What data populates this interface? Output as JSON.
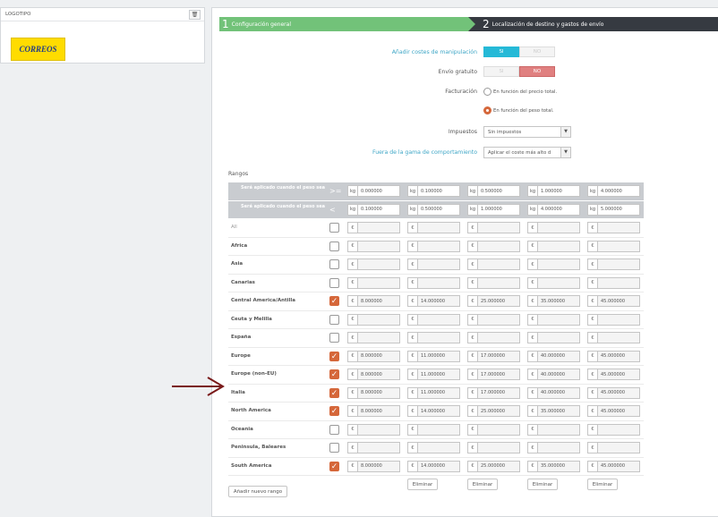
{
  "logo_panel": {
    "title": "LOGOTIPO",
    "trash_icon": "trash-icon",
    "logo_text": "CORREOS"
  },
  "steps": [
    {
      "num": "1",
      "label": "Configuración general"
    },
    {
      "num": "2",
      "label": "Localización de destino y gastos de envío"
    }
  ],
  "form": {
    "handling_label": "Añadir costes de manipulación",
    "handling_yes": "SI",
    "handling_no": "NO",
    "free_label": "Envío gratuito",
    "free_yes": "SI",
    "free_no": "NO",
    "billing_label": "Facturación",
    "billing_opt1": "En función del precio total.",
    "billing_opt2": "En función del peso total.",
    "taxes_label": "Impuestos",
    "taxes_value": "Sin impuestos",
    "out_of_range_label": "Fuera de la gama de comportamiento",
    "out_of_range_value": "Aplicar el coste más alto d"
  },
  "ranges": {
    "title": "Rangos",
    "header_ge": {
      "desc": "Será aplicado cuando el peso sea",
      "op": ">=",
      "unit": "kg",
      "values": [
        "0.000000",
        "0.100000",
        "0.500000",
        "1.000000",
        "4.000000"
      ]
    },
    "header_lt": {
      "desc": "Será aplicado cuando el peso sea",
      "op": "<",
      "unit": "kg",
      "values": [
        "0.100000",
        "0.500000",
        "1.000000",
        "4.000000",
        "5.000000"
      ]
    },
    "currency": "€",
    "zones": [
      {
        "name": "All",
        "checked": false,
        "prices": [
          "",
          "",
          "",
          "",
          ""
        ]
      },
      {
        "name": "Africa",
        "checked": false,
        "prices": [
          "",
          "",
          "",
          "",
          ""
        ]
      },
      {
        "name": "Asia",
        "checked": false,
        "prices": [
          "",
          "",
          "",
          "",
          ""
        ]
      },
      {
        "name": "Canarias",
        "checked": false,
        "prices": [
          "",
          "",
          "",
          "",
          ""
        ]
      },
      {
        "name": "Central America/Antilla",
        "checked": true,
        "prices": [
          "8.000000",
          "14.000000",
          "25.000000",
          "35.000000",
          "45.000000"
        ]
      },
      {
        "name": "Ceuta y Melilla",
        "checked": false,
        "prices": [
          "",
          "",
          "",
          "",
          ""
        ]
      },
      {
        "name": "España",
        "checked": false,
        "prices": [
          "",
          "",
          "",
          "",
          ""
        ]
      },
      {
        "name": "Europe",
        "checked": true,
        "prices": [
          "8.000000",
          "11.000000",
          "17.000000",
          "40.000000",
          "45.000000"
        ]
      },
      {
        "name": "Europe (non-EU)",
        "checked": true,
        "prices": [
          "8.000000",
          "11.000000",
          "17.000000",
          "40.000000",
          "45.000000"
        ]
      },
      {
        "name": "Italia",
        "checked": true,
        "prices": [
          "8.000000",
          "11.000000",
          "17.000000",
          "40.000000",
          "45.000000"
        ]
      },
      {
        "name": "North America",
        "checked": true,
        "prices": [
          "8.000000",
          "14.000000",
          "25.000000",
          "35.000000",
          "45.000000"
        ]
      },
      {
        "name": "Oceania",
        "checked": false,
        "prices": [
          "",
          "",
          "",
          "",
          ""
        ]
      },
      {
        "name": "Peninsula, Baleares",
        "checked": false,
        "prices": [
          "",
          "",
          "",
          "",
          ""
        ]
      },
      {
        "name": "South America",
        "checked": true,
        "prices": [
          "8.000000",
          "14.000000",
          "25.000000",
          "35.000000",
          "45.000000"
        ]
      }
    ],
    "delete_label": "Eliminar",
    "add_label": "Añadir nuevo rango"
  },
  "colors": {
    "step_active": "#72c279",
    "step_inactive": "#363a41",
    "checkbox_checked": "#d5673a",
    "annotation_arrow": "#7a1a1a"
  }
}
